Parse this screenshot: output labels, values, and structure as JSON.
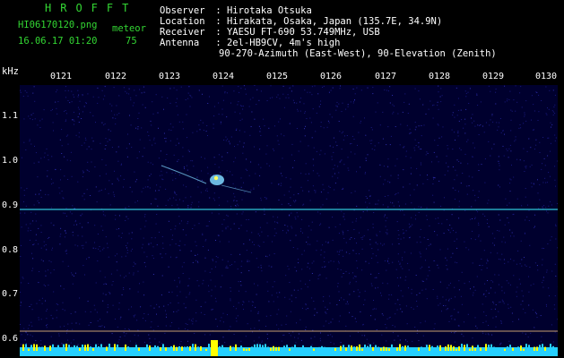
{
  "header": {
    "logo": "HROFFT",
    "filename": "HI06170120.png",
    "datetime": "16.06.17 01:20",
    "count_label": "meteor",
    "count_value": "75"
  },
  "station": {
    "observer_label": "Observer",
    "observer": "Hirotaka Otsuka",
    "location_label": "Location",
    "location": "Hirakata, Osaka, Japan (135.7E, 34.9N)",
    "receiver_label": "Receiver",
    "receiver": "YAESU FT-690 53.749MHz, USB",
    "antenna_label": "Antenna",
    "antenna": "2el-HB9CV, 4m's high",
    "antenna_detail": "90-270-Azimuth (East-West), 90-Elevation (Zenith)"
  },
  "axes": {
    "y_unit": "kHz",
    "x_ticks": [
      "0121",
      "0122",
      "0123",
      "0124",
      "0125",
      "0126",
      "0127",
      "0128",
      "0129",
      "0130"
    ],
    "y_ticks": [
      "1.1",
      "1.0",
      "0.9",
      "0.8",
      "0.7",
      "0.6"
    ]
  },
  "colors": {
    "background": "#000000",
    "plot_background": "#00002e",
    "noise": "#1a1a80",
    "carrier_line": "#2fc8d8",
    "meteor": "#7fd8ff",
    "meteor_core": "#ffff60",
    "baseline": "#c8a070",
    "bottom_band_cyan": "#25d0ff",
    "bottom_band_yellow": "#ffff00",
    "text_green": "#33d633",
    "text_white": "#ffffff"
  }
}
